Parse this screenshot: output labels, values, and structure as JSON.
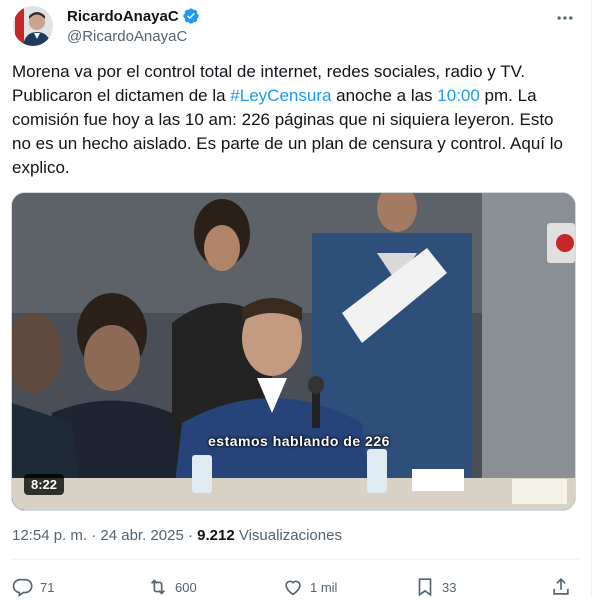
{
  "author": {
    "display_name": "RicardoAnayaC",
    "handle": "@RicardoAnayaC"
  },
  "tweet": {
    "text_1": "Morena va por el control total de internet, redes sociales, radio y TV. Publicaron el dictamen de la ",
    "hashtag": "#LeyCensura",
    "text_2": " anoche a las ",
    "time_link": "10:00",
    "text_3": " pm. La comisión fue hoy a las 10 am: 226 páginas que ni siquiera leyeron. Esto no es un hecho aislado. Es parte de un plan de censura y control. Aquí lo explico."
  },
  "video": {
    "caption": "estamos hablando de 226",
    "duration": "8:22"
  },
  "meta": {
    "posted": "12:54 p. m. · 24 abr. 2025 · ",
    "views_count": "9.212",
    "views_label": " Visualizaciones"
  },
  "actions": {
    "replies": "71",
    "reposts": "600",
    "likes": "1 mil",
    "bookmarks": "33"
  },
  "icons": [
    "verified-badge-icon",
    "more-icon",
    "reply-icon",
    "repost-icon",
    "like-icon",
    "bookmark-icon",
    "share-icon"
  ],
  "colors": {
    "accent": "#1d9bf0",
    "muted": "#536471",
    "text": "#0f1419"
  }
}
